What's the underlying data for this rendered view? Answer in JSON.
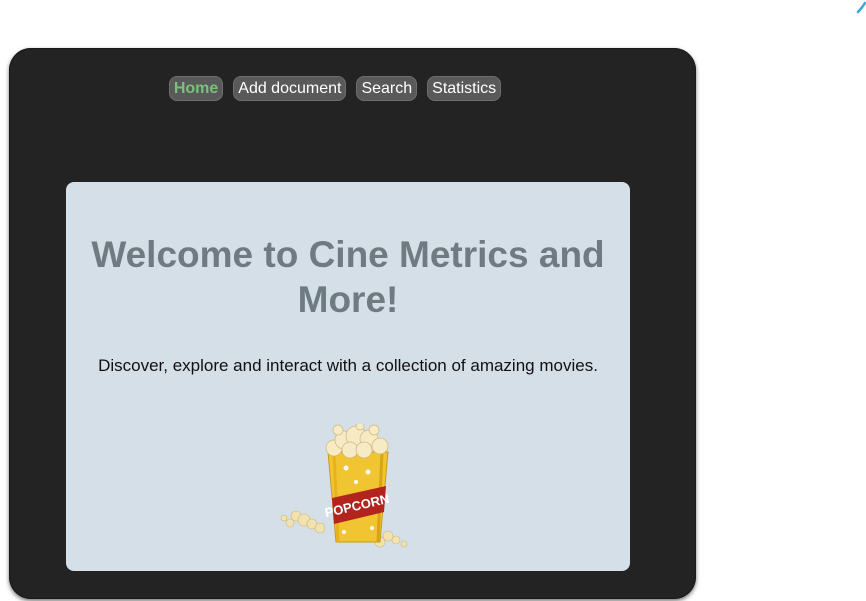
{
  "nav": {
    "items": [
      {
        "label": "Home",
        "active": true
      },
      {
        "label": "Add document",
        "active": false
      },
      {
        "label": "Search",
        "active": false
      },
      {
        "label": "Statistics",
        "active": false
      }
    ]
  },
  "main": {
    "heading": "Welcome to Cine Metrics and More!",
    "tagline": "Discover, explore and interact with a collection of amazing movies.",
    "image": {
      "icon": "popcorn-bucket-icon",
      "text": "POPCORN"
    }
  },
  "colors": {
    "frame": "#232323",
    "content_bg": "#d5dfe8",
    "heading": "#6e7b81",
    "nav_button": "#595959",
    "nav_active_text": "#78c17a",
    "popcorn_bucket": "#f0c531",
    "corner_accent": "#35a8d8"
  }
}
